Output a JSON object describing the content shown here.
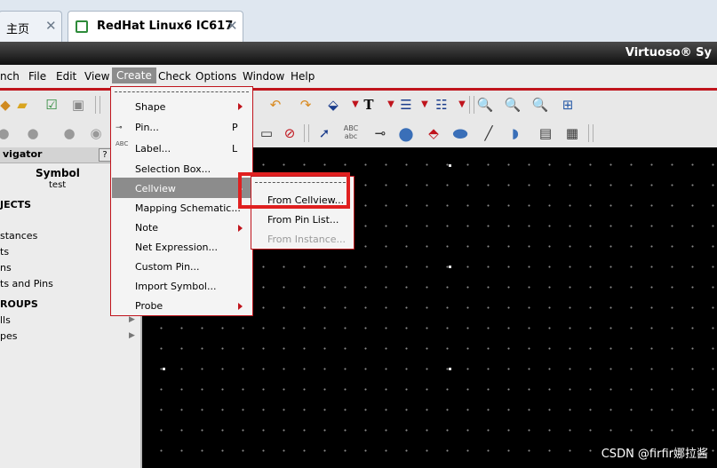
{
  "browser": {
    "tabs": [
      {
        "label": "主页",
        "close": "✕"
      },
      {
        "label": "RedHat Linux6 IC617",
        "close": "✕"
      }
    ]
  },
  "window": {
    "title": "Virtuoso® Sy"
  },
  "menubar": {
    "items": [
      "nch",
      "File",
      "Edit",
      "View",
      "Create",
      "Check",
      "Options",
      "Window",
      "Help"
    ]
  },
  "create_menu": {
    "items": [
      {
        "label": "Shape",
        "accel": "",
        "submenu": true
      },
      {
        "label": "Pin...",
        "accel": "P",
        "submenu": false
      },
      {
        "label": "Label...",
        "accel": "L",
        "submenu": false
      },
      {
        "label": "Selection Box...",
        "accel": "",
        "submenu": false
      },
      {
        "label": "Cellview",
        "accel": "",
        "submenu": true
      },
      {
        "label": "Mapping Schematic...",
        "accel": "",
        "submenu": false
      },
      {
        "label": "Note",
        "accel": "",
        "submenu": true
      },
      {
        "label": "Net Expression...",
        "accel": "",
        "submenu": false
      },
      {
        "label": "Custom Pin...",
        "accel": "",
        "submenu": false
      },
      {
        "label": "Import Symbol...",
        "accel": "",
        "submenu": false
      },
      {
        "label": "Probe",
        "accel": "",
        "submenu": true
      }
    ],
    "label_icon_text": "ABC"
  },
  "cellview_submenu": {
    "items": [
      {
        "label": "From Cellview...",
        "enabled": true
      },
      {
        "label": "From Pin List...",
        "enabled": true
      },
      {
        "label": "From Instance...",
        "enabled": false
      }
    ]
  },
  "toolbar": {
    "abc_icon_text": "ABC",
    "text_icon": "T",
    "text_icon_abc": "abc"
  },
  "navigator": {
    "title": "vigator",
    "help": "?",
    "cell_name": "Symbol",
    "cell_view": "test",
    "sections": [
      {
        "heading": "JECTS",
        "items": [
          "stances",
          "ts",
          "ns",
          "ts and Pins"
        ]
      },
      {
        "heading": "ROUPS",
        "items": [
          "lls",
          "pes"
        ]
      }
    ]
  },
  "watermark": "CSDN @firfir娜拉酱",
  "colors": {
    "accent": "#c0141c",
    "highlight": "#e02020",
    "canvas": "#000000"
  }
}
